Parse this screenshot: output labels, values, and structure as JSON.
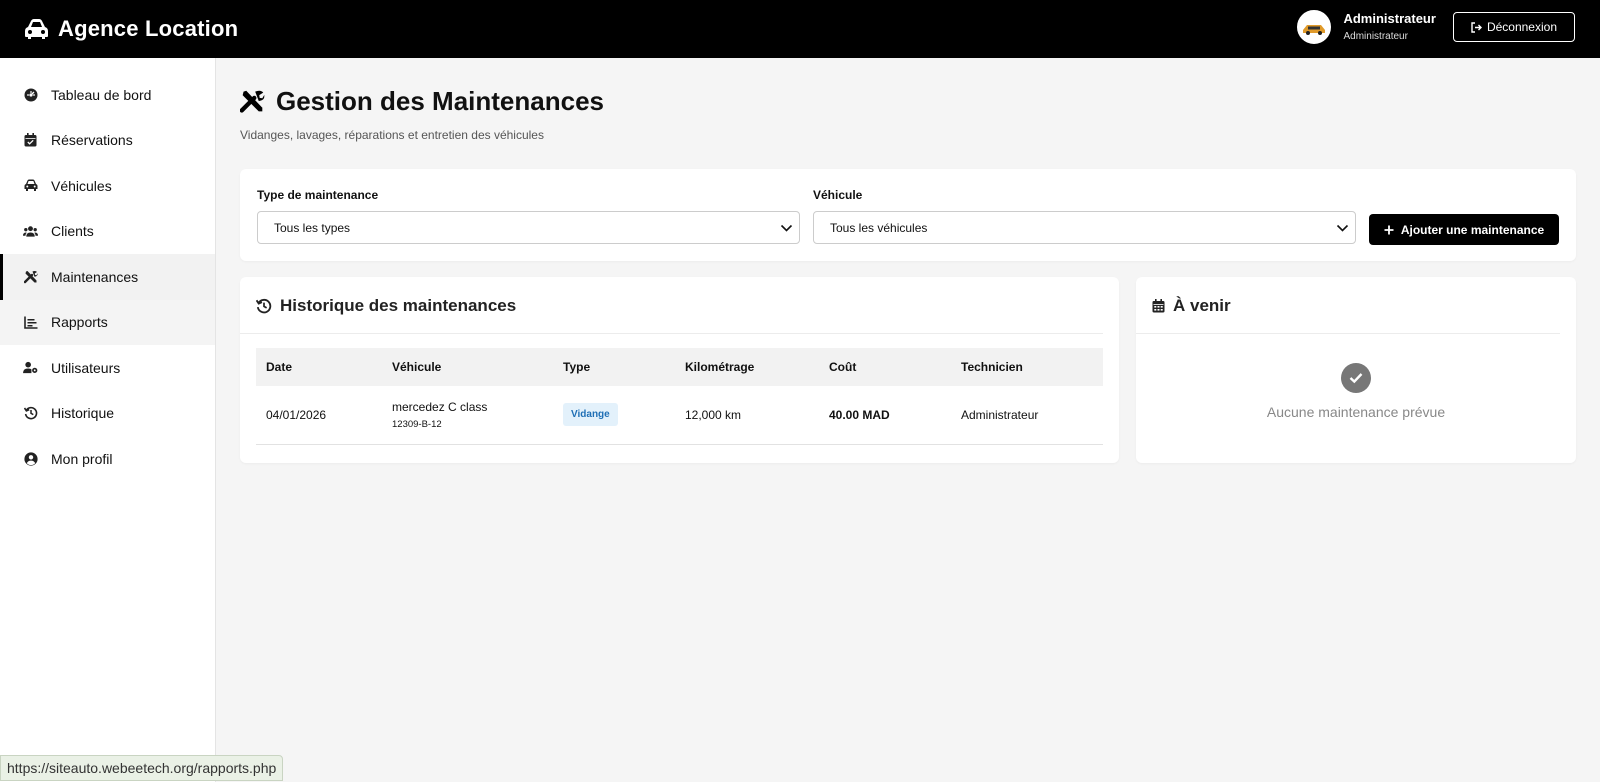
{
  "topbar": {
    "brand": "Agence Location",
    "user_name": "Administrateur",
    "user_role": "Administrateur",
    "logout_label": "Déconnexion"
  },
  "sidebar": {
    "items": [
      {
        "label": "Tableau de bord",
        "icon": "gauge-icon"
      },
      {
        "label": "Réservations",
        "icon": "calendar-check-icon"
      },
      {
        "label": "Véhicules",
        "icon": "car-icon"
      },
      {
        "label": "Clients",
        "icon": "users-icon"
      },
      {
        "label": "Maintenances",
        "icon": "tools-icon"
      },
      {
        "label": "Rapports",
        "icon": "chart-line-icon"
      },
      {
        "label": "Utilisateurs",
        "icon": "user-gear-icon"
      },
      {
        "label": "Historique",
        "icon": "history-icon"
      },
      {
        "label": "Mon profil",
        "icon": "user-circle-icon"
      }
    ],
    "active": "Maintenances"
  },
  "page": {
    "title": "Gestion des Maintenances",
    "subtitle": "Vidanges, lavages, réparations et entretien des véhicules"
  },
  "filters": {
    "type_label": "Type de maintenance",
    "type_value": "Tous les types",
    "vehicle_label": "Véhicule",
    "vehicle_value": "Tous les véhicules",
    "add_label": "Ajouter une maintenance"
  },
  "history": {
    "title": "Historique des maintenances",
    "columns": [
      "Date",
      "Véhicule",
      "Type",
      "Kilométrage",
      "Coût",
      "Technicien"
    ],
    "rows": [
      {
        "date": "04/01/2026",
        "vehicle": "mercedez C class",
        "plate": "12309-B-12",
        "type": "Vidange",
        "mileage": "12,000 km",
        "cost": "40.00 MAD",
        "technician": "Administrateur"
      }
    ]
  },
  "upcoming": {
    "title": "À venir",
    "empty_text": "Aucune maintenance prévue"
  },
  "status_url": "https://siteauto.webeetech.org/rapports.php",
  "colors": {
    "topbar": "#000000",
    "badge_bg": "#e3f1fb",
    "badge_text": "#1f6fb5"
  }
}
